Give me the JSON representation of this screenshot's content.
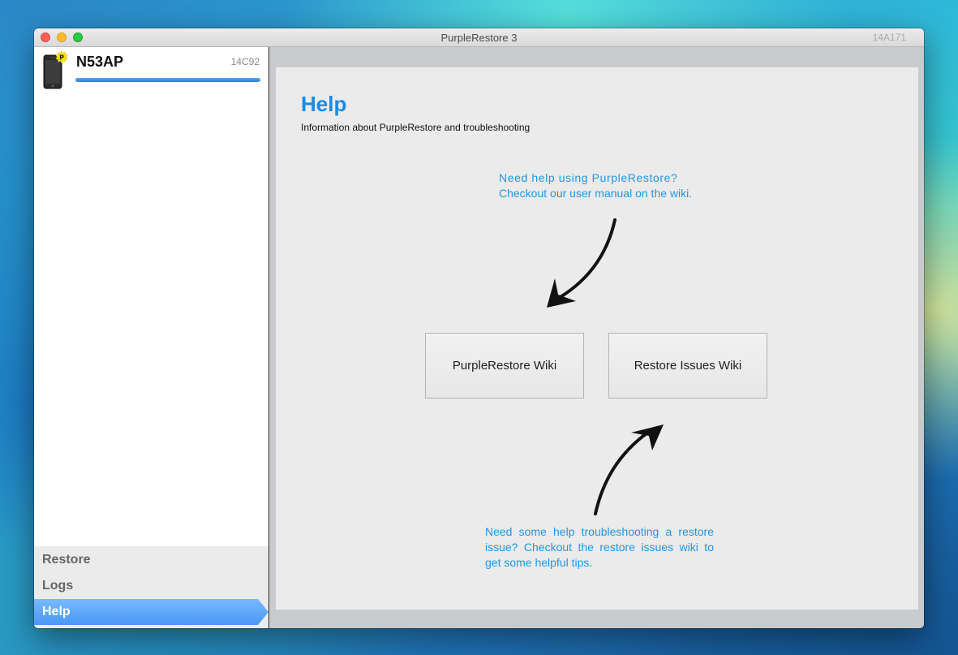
{
  "window": {
    "title": "PurpleRestore 3",
    "build_label": "14A171"
  },
  "device": {
    "name": "N53AP",
    "build": "14C92",
    "badge_letter": "P",
    "progress_fraction": 1.0
  },
  "nav": {
    "items": [
      {
        "label": "Restore"
      },
      {
        "label": "Logs"
      },
      {
        "label": "Help"
      }
    ],
    "active": "Help"
  },
  "help": {
    "title": "Help",
    "subtitle": "Information about PurpleRestore and troubleshooting",
    "note_top_line1": "Need help using PurpleRestore?",
    "note_top_line2": "Checkout our user manual on the wiki.",
    "note_bottom": "Need some help troubleshooting a restore issue? Checkout the restore issues wiki to get some helpful tips.",
    "buttons": {
      "purplerestore_wiki": "PurpleRestore Wiki",
      "restore_issues_wiki": "Restore Issues Wiki"
    }
  },
  "colors": {
    "accent": "#1a8be8",
    "note_text": "#2196e6",
    "active_nav": "#5aa8ff"
  },
  "icons": {
    "device": "iphone-icon",
    "badge": "purple-p-badge-icon",
    "arrows": [
      "curved-arrow-down-left-icon",
      "curved-arrow-up-right-icon"
    ]
  }
}
